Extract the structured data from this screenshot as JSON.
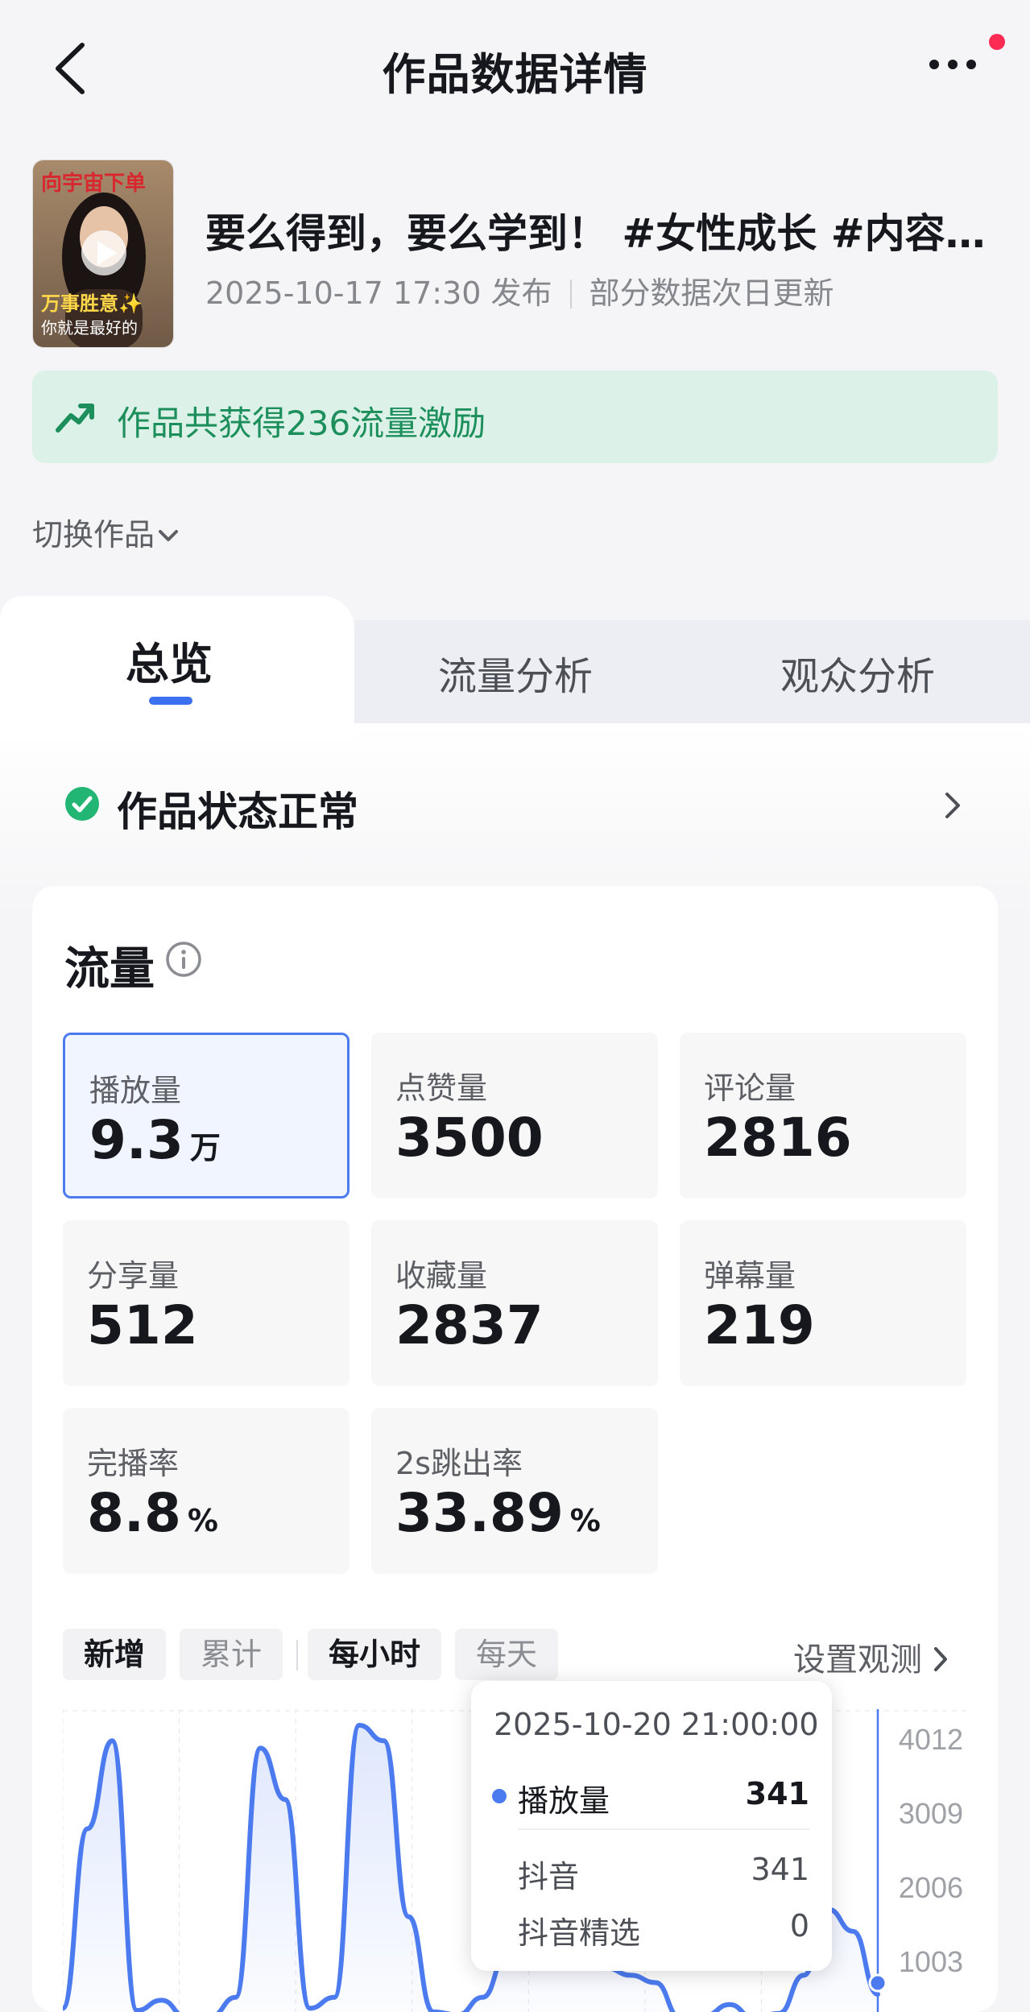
{
  "header": {
    "title": "作品数据详情"
  },
  "work": {
    "title": "要么得到，要么学到！ #女性成长 #内容过…",
    "date": "2025-10-17 17:30 发布",
    "note": "部分数据次日更新",
    "thumb_top_text": "向宇宙下单",
    "thumb_bottom_text1": "万事胜意✨",
    "thumb_bottom_text2": "你就是最好的"
  },
  "banner": {
    "text": "作品共获得236流量激励"
  },
  "switch_label": "切换作品",
  "tabs": [
    {
      "label": "总览",
      "active": true
    },
    {
      "label": "流量分析",
      "active": false
    },
    {
      "label": "观众分析",
      "active": false
    }
  ],
  "status": {
    "text": "作品状态正常"
  },
  "traffic": {
    "title": "流量",
    "metrics": [
      {
        "label": "播放量",
        "value": "9.3",
        "unit": "万"
      },
      {
        "label": "点赞量",
        "value": "3500",
        "unit": ""
      },
      {
        "label": "评论量",
        "value": "2816",
        "unit": ""
      },
      {
        "label": "分享量",
        "value": "512",
        "unit": ""
      },
      {
        "label": "收藏量",
        "value": "2837",
        "unit": ""
      },
      {
        "label": "弹幕量",
        "value": "219",
        "unit": ""
      },
      {
        "label": "完播率",
        "value": "8.8",
        "unit": "%"
      },
      {
        "label": "2s跳出率",
        "value": "33.89",
        "unit": "%"
      }
    ],
    "filters": {
      "mode": [
        "新增",
        "累计"
      ],
      "granularity": [
        "每小时",
        "每天"
      ],
      "observe_label": "设置观测"
    }
  },
  "tooltip": {
    "time": "2025-10-20 21:00:00",
    "series_label": "播放量",
    "series_value": "341",
    "sub_rows": [
      {
        "label": "抖音",
        "value": "341"
      },
      {
        "label": "抖音精选",
        "value": "0"
      }
    ]
  },
  "colors": {
    "accent": "#4c7bf0",
    "success": "#1d8f5c",
    "banner_bg": "#dcf2e8",
    "notification": "#fe2c55"
  },
  "chart_data": {
    "type": "area",
    "series": [
      {
        "name": "播放量",
        "values": [
          150,
          2600,
          3800,
          120,
          260,
          30,
          40,
          300,
          3700,
          3000,
          150,
          300,
          4012,
          3800,
          1400,
          100,
          60,
          300,
          900,
          1500,
          800,
          1100,
          700,
          600,
          500,
          20,
          50,
          200,
          10,
          80,
          600,
          1500,
          1200,
          341
        ]
      }
    ],
    "yticks": [
      "4012",
      "3009",
      "2006",
      "1003"
    ],
    "ylim": [
      0,
      4012
    ]
  }
}
